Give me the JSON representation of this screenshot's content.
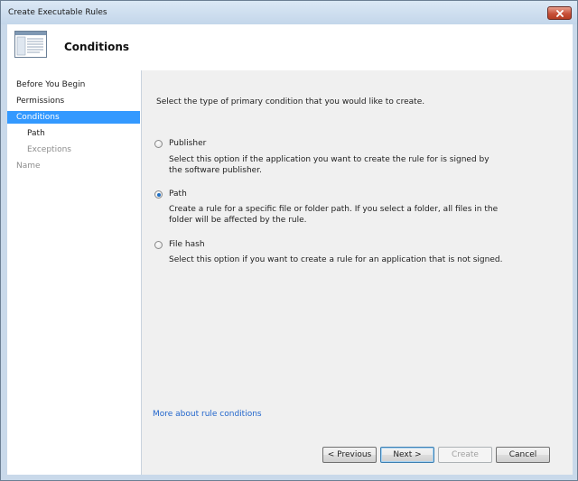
{
  "window": {
    "title": "Create Executable Rules"
  },
  "header": {
    "heading": "Conditions"
  },
  "nav": {
    "items": [
      {
        "label": "Before You Begin",
        "state": "normal"
      },
      {
        "label": "Permissions",
        "state": "normal"
      },
      {
        "label": "Conditions",
        "state": "selected"
      },
      {
        "label": "Path",
        "state": "normal"
      },
      {
        "label": "Exceptions",
        "state": "disabled"
      },
      {
        "label": "Name",
        "state": "disabled"
      }
    ]
  },
  "main": {
    "prompt": "Select the type of primary condition that you would like to create.",
    "options": [
      {
        "label": "Publisher",
        "checked": false,
        "description": "Select this option if the application you want to create the rule for is signed by the software publisher."
      },
      {
        "label": "Path",
        "checked": true,
        "description": "Create a rule for a specific file or folder path. If you select a folder, all files in the folder will be affected by the rule."
      },
      {
        "label": "File hash",
        "checked": false,
        "description": "Select this option if you want to create a rule for an application that is not signed."
      }
    ],
    "more_link": "More about rule conditions"
  },
  "footer": {
    "previous": "< Previous",
    "next": "Next >",
    "create": "Create",
    "cancel": "Cancel"
  },
  "colors": {
    "selection": "#3399ff",
    "link": "#2266cc",
    "close": "#c8513a"
  },
  "icons": {
    "close": "close-x-icon",
    "header": "wizard-window-icon"
  }
}
